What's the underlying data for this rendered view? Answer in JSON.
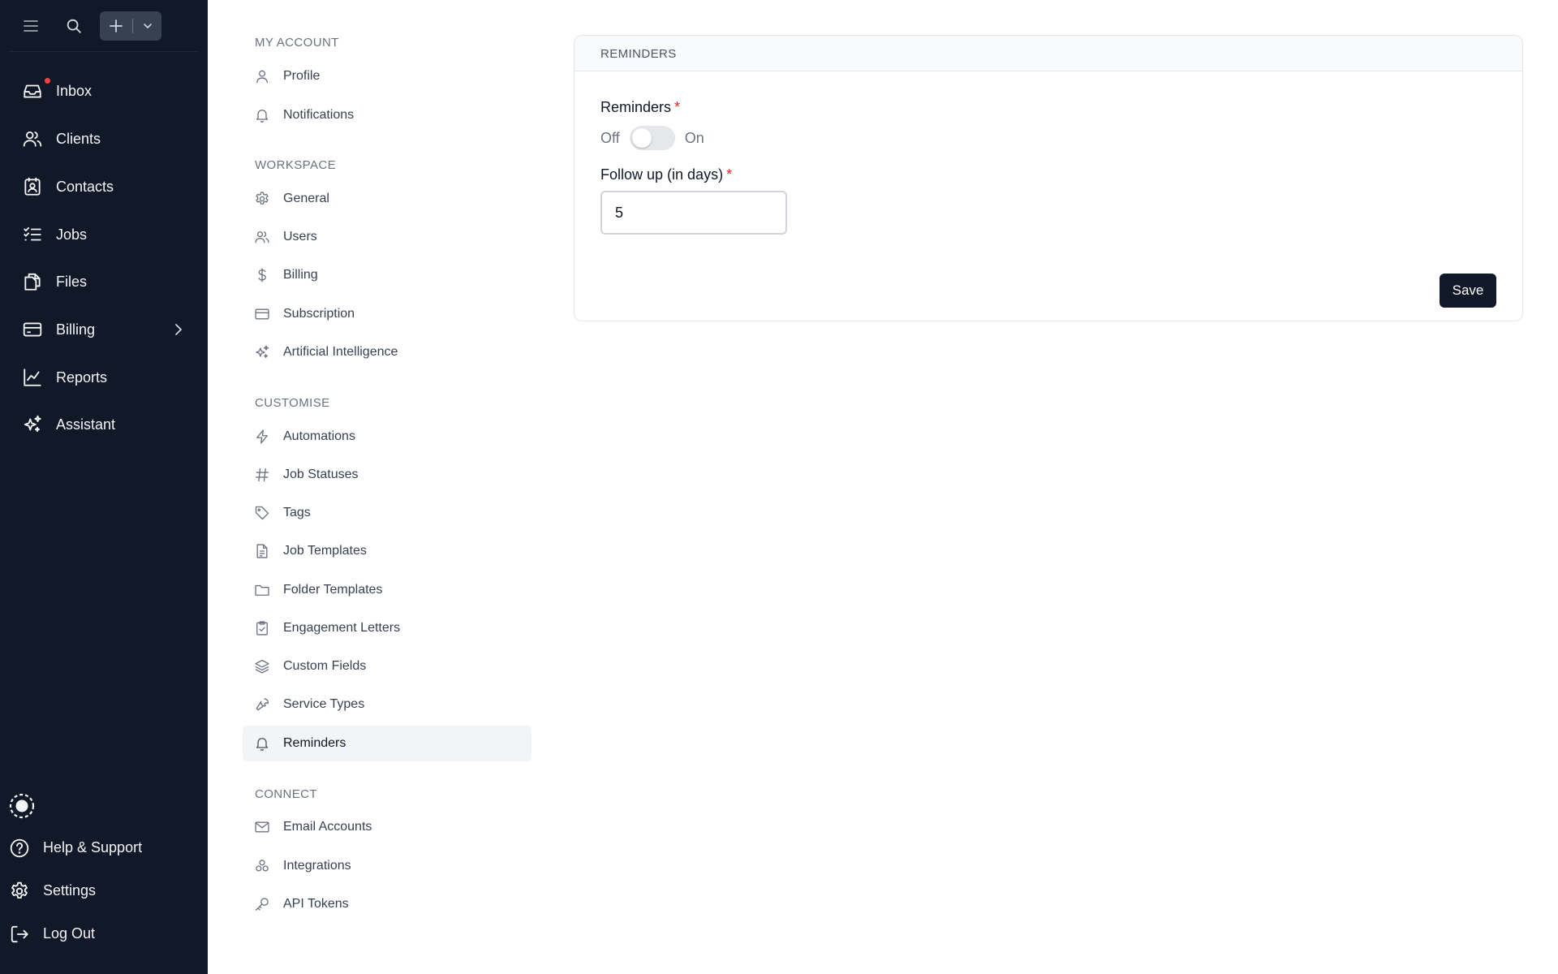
{
  "app": {
    "colors": {
      "sidebar_bg": "#111827",
      "accent": "#111827",
      "notification": "#ef4444",
      "required": "#dc2626"
    }
  },
  "topbar": {
    "menu_icon": "hamburger-menu-icon",
    "search_icon": "search-icon",
    "new_button_icons": [
      "plus-icon",
      "chevron-down-icon"
    ]
  },
  "sidebar": {
    "items": [
      {
        "label": "Inbox",
        "icon": "inbox-icon",
        "has_notification": true
      },
      {
        "label": "Clients",
        "icon": "users-icon"
      },
      {
        "label": "Contacts",
        "icon": "contact-card-icon"
      },
      {
        "label": "Jobs",
        "icon": "checklist-icon"
      },
      {
        "label": "Files",
        "icon": "files-icon"
      },
      {
        "label": "Billing",
        "icon": "credit-card-icon",
        "expandable": true
      },
      {
        "label": "Reports",
        "icon": "line-chart-icon"
      },
      {
        "label": "Assistant",
        "icon": "sparkles-icon"
      }
    ],
    "bottom": [
      {
        "label": "Help & Support",
        "icon": "help-circle-icon"
      },
      {
        "label": "Settings",
        "icon": "gear-icon"
      },
      {
        "label": "Log Out",
        "icon": "logout-icon"
      }
    ]
  },
  "settings_menu": {
    "sections": [
      {
        "title": "MY ACCOUNT",
        "items": [
          {
            "label": "Profile",
            "icon": "user-icon"
          },
          {
            "label": "Notifications",
            "icon": "bell-icon"
          }
        ]
      },
      {
        "title": "WORKSPACE",
        "items": [
          {
            "label": "General",
            "icon": "gear-icon"
          },
          {
            "label": "Users",
            "icon": "users-icon"
          },
          {
            "label": "Billing",
            "icon": "dollar-icon"
          },
          {
            "label": "Subscription",
            "icon": "credit-card-icon"
          },
          {
            "label": "Artificial Intelligence",
            "icon": "sparkles-icon"
          }
        ]
      },
      {
        "title": "CUSTOMISE",
        "items": [
          {
            "label": "Automations",
            "icon": "lightning-icon"
          },
          {
            "label": "Job Statuses",
            "icon": "hash-icon"
          },
          {
            "label": "Tags",
            "icon": "tag-icon"
          },
          {
            "label": "Job Templates",
            "icon": "document-icon"
          },
          {
            "label": "Folder Templates",
            "icon": "folder-icon"
          },
          {
            "label": "Engagement Letters",
            "icon": "clipboard-check-icon"
          },
          {
            "label": "Custom Fields",
            "icon": "layers-icon"
          },
          {
            "label": "Service Types",
            "icon": "wrench-icon"
          },
          {
            "label": "Reminders",
            "icon": "bell-icon",
            "active": true
          }
        ]
      },
      {
        "title": "CONNECT",
        "items": [
          {
            "label": "Email Accounts",
            "icon": "mail-icon"
          },
          {
            "label": "Integrations",
            "icon": "integrations-icon"
          },
          {
            "label": "API Tokens",
            "icon": "key-icon"
          }
        ]
      }
    ]
  },
  "main": {
    "card_title": "REMINDERS",
    "reminders_label": "Reminders",
    "required_mark": "*",
    "toggle": {
      "off_label": "Off",
      "on_label": "On",
      "state": "off"
    },
    "follow_up_label": "Follow up (in days)",
    "follow_up_value": "5",
    "save_label": "Save"
  }
}
